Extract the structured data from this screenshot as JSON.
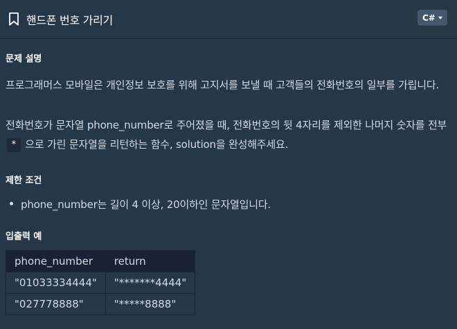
{
  "header": {
    "title": "핸드폰 번호 가리기",
    "language": "C#"
  },
  "description": {
    "heading": "문제 설명",
    "line1": "프로그래머스 모바일은 개인정보 보호를 위해 고지서를 보낼 때 고객들의 전화번호의 일부를 가립니다.",
    "line2a": "전화번호가 문자열 phone_number로 주어졌을 때, 전화번호의 뒷 4자리를 제외한 나머지 숫자를 전부",
    "line2_code": "*",
    "line2b": "으로 가린 문자열을 리턴하는 함수, solution을 완성해주세요."
  },
  "constraints": {
    "heading": "제한 조건",
    "items": [
      "phone_number는 길이 4 이상, 20이하인 문자열입니다."
    ]
  },
  "examples": {
    "heading": "입출력 예",
    "columns": [
      "phone_number",
      "return"
    ],
    "rows": [
      [
        "\"01033334444\"",
        "\"*******4444\""
      ],
      [
        "\"027778888\"",
        "\"*****8888\""
      ]
    ]
  }
}
